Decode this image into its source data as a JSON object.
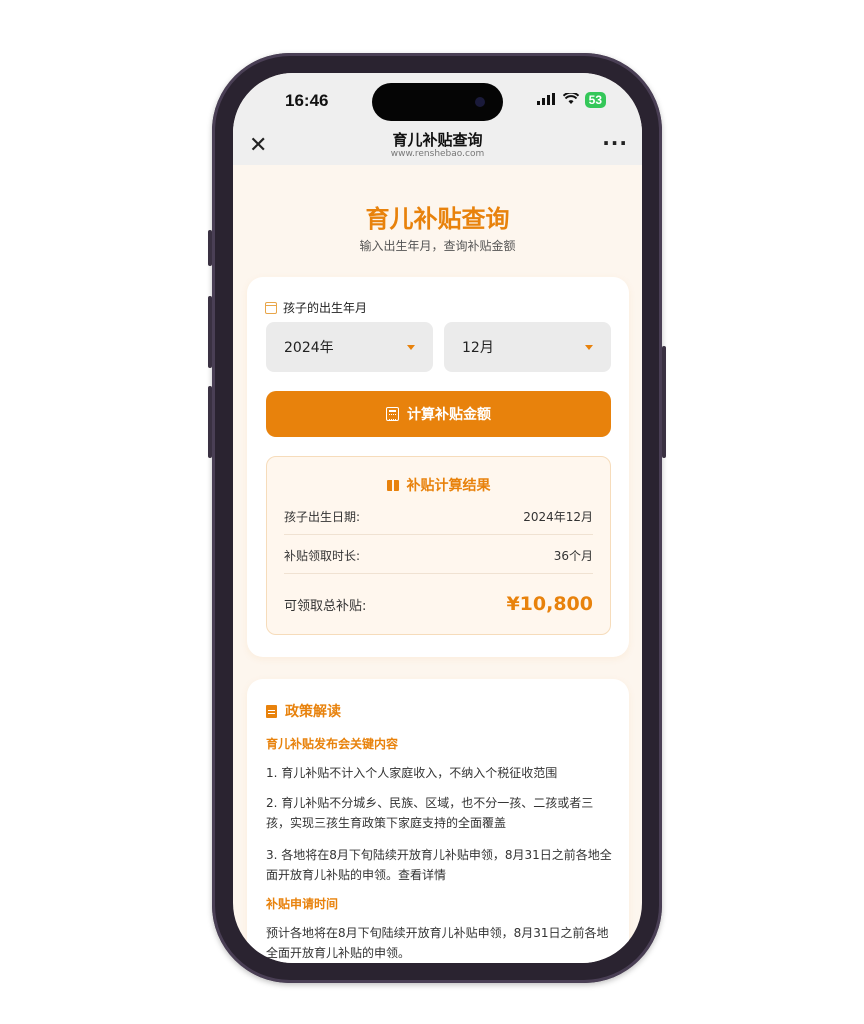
{
  "status_bar": {
    "time": "16:46",
    "signal": "::!!",
    "wifi": "wifi",
    "battery": "53"
  },
  "nav": {
    "close": "✕",
    "title": "育儿补贴查询",
    "url": "www.renshebao.com",
    "more": "···"
  },
  "header": {
    "title": "育儿补贴查询",
    "subtitle": "输入出生年月，查询补贴金额"
  },
  "form": {
    "label": "孩子的出生年月",
    "year_value": "2024年",
    "month_value": "12月",
    "button_label": "计算补贴金额"
  },
  "result": {
    "title": "补贴计算结果",
    "rows": [
      {
        "label": "孩子出生日期:",
        "value": "2024年12月"
      },
      {
        "label": "补贴领取时长:",
        "value": "36个月"
      }
    ],
    "total_label": "可领取总补贴:",
    "total_value": "¥10,800"
  },
  "policy": {
    "title": "政策解读",
    "section1_title": "育儿补贴发布会关键内容",
    "items": [
      "1. 育儿补贴不计入个人家庭收入，不纳入个税征收范围",
      "2. 育儿补贴不分城乡、民族、区域，也不分一孩、二孩或者三孩，实现三孩生育政策下家庭支持的全面覆盖",
      "3. 各地将在8月下旬陆续开放育儿补贴申领，8月31日之前各地全面开放育儿补贴的申领。查看详情"
    ],
    "section2_title": "补贴申请时间",
    "section2_text": "预计各地将在8月下旬陆续开放育儿补贴申领，8月31日之前各地全面开放育儿补贴的申领。"
  },
  "colors": {
    "accent": "#e8820c",
    "page_bg": "#fdf6ee",
    "result_bg": "#fff7ee"
  }
}
